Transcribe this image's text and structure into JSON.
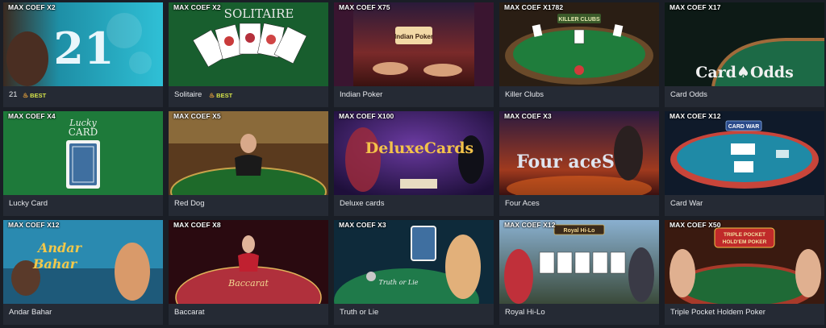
{
  "games": [
    {
      "title": "21",
      "coef": "MAX COEF X2",
      "badge": "BEST",
      "icon": "fire-icon"
    },
    {
      "title": "Solitaire",
      "coef": "MAX COEF X2",
      "badge": "BEST",
      "icon": "fire-icon"
    },
    {
      "title": "Indian Poker",
      "coef": "MAX COEF X75"
    },
    {
      "title": "Killer Clubs",
      "coef": "MAX COEF X1782"
    },
    {
      "title": "Card Odds",
      "coef": "MAX COEF X17"
    },
    {
      "title": "Lucky Card",
      "coef": "MAX COEF X4"
    },
    {
      "title": "Red Dog",
      "coef": "MAX COEF X5"
    },
    {
      "title": "Deluxe cards",
      "coef": "MAX COEF X100"
    },
    {
      "title": "Four Aces",
      "coef": "MAX COEF X3"
    },
    {
      "title": "Card War",
      "coef": "MAX COEF X12"
    },
    {
      "title": "Andar Bahar",
      "coef": "MAX COEF X12"
    },
    {
      "title": "Baccarat",
      "coef": "MAX COEF X8"
    },
    {
      "title": "Truth or Lie",
      "coef": "MAX COEF X3"
    },
    {
      "title": "Royal Hi-Lo",
      "coef": "MAX COEF X12"
    },
    {
      "title": "Triple Pocket Holdem Poker",
      "coef": "MAX COEF X50"
    }
  ],
  "art": {
    "blackjack_number": "21",
    "solitaire_logo": "SOLITAIRE",
    "indian_poker_logo": "Indian Poker",
    "killer_clubs_logo": "KILLER CLUBS",
    "card_odds_logo": "Card♠Odds",
    "lucky_card_logo_1": "Lucky",
    "lucky_card_logo_2": "CARD",
    "deluxe_logo": "DeluxeCards",
    "four_aces_logo": "Four aceS",
    "card_war_logo": "CARD WAR",
    "andar_logo": "Andar",
    "bahar_logo": "Bahar",
    "baccarat_logo": "Baccarat",
    "truth_logo": "Truth or Lie",
    "royal_logo": "Royal Hi-Lo",
    "triple_logo_1": "TRIPLE POCKET",
    "triple_logo_2": "HOLD'EM POKER"
  },
  "colors": {
    "page_bg": "#1a1e26",
    "card_bg": "#252a34",
    "best": "#d6e34a"
  }
}
